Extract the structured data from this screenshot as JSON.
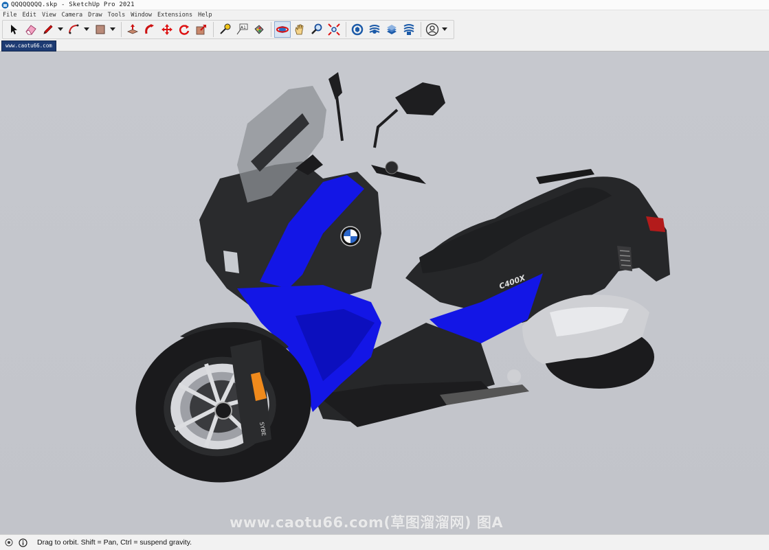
{
  "window": {
    "title": "QQQQQQQQ.skp - SketchUp Pro 2021"
  },
  "menu": [
    "File",
    "Edit",
    "View",
    "Camera",
    "Draw",
    "Tools",
    "Window",
    "Extensions",
    "Help"
  ],
  "toolbar": {
    "tools": [
      {
        "name": "select",
        "icon": "arrow-cursor-icon"
      },
      {
        "name": "eraser",
        "icon": "eraser-icon"
      },
      {
        "name": "pencil",
        "icon": "pencil-icon",
        "dropdown": true
      },
      {
        "name": "arc",
        "icon": "arc-icon",
        "dropdown": true
      },
      {
        "name": "rectangle",
        "icon": "rectangle-icon",
        "dropdown": true
      },
      {
        "name": "push-pull",
        "icon": "push-pull-icon"
      },
      {
        "name": "follow-me",
        "icon": "follow-me-icon"
      },
      {
        "name": "move",
        "icon": "move-icon"
      },
      {
        "name": "rotate",
        "icon": "rotate-icon"
      },
      {
        "name": "scale",
        "icon": "scale-icon"
      },
      {
        "name": "tape-measure",
        "icon": "tape-measure-icon"
      },
      {
        "name": "text",
        "icon": "text-icon"
      },
      {
        "name": "paint-bucket",
        "icon": "paint-bucket-icon"
      },
      {
        "name": "orbit",
        "icon": "orbit-icon",
        "active": true
      },
      {
        "name": "pan",
        "icon": "hand-icon"
      },
      {
        "name": "zoom",
        "icon": "zoom-icon"
      },
      {
        "name": "zoom-extents",
        "icon": "zoom-extents-icon"
      },
      {
        "name": "3d-warehouse",
        "icon": "warehouse-icon"
      },
      {
        "name": "extension-warehouse",
        "icon": "extension-warehouse-icon"
      },
      {
        "name": "layout",
        "icon": "layout-icon"
      },
      {
        "name": "extension-manager",
        "icon": "extension-manager-icon"
      },
      {
        "name": "account",
        "icon": "user-account-icon",
        "dropdown": true
      }
    ]
  },
  "scene_tab": {
    "label": "www.caotu66.com"
  },
  "watermark": {
    "text": "www.caotu66.com(草图溜溜网) 图A"
  },
  "status": {
    "text": "Drag to orbit. Shift = Pan, Ctrl = suspend gravity."
  },
  "colors": {
    "accent_tab": "#1d3b73",
    "scooter_blue": "#1316e6",
    "scooter_black": "#262729",
    "viewport_bg": "#c4c6cc"
  }
}
